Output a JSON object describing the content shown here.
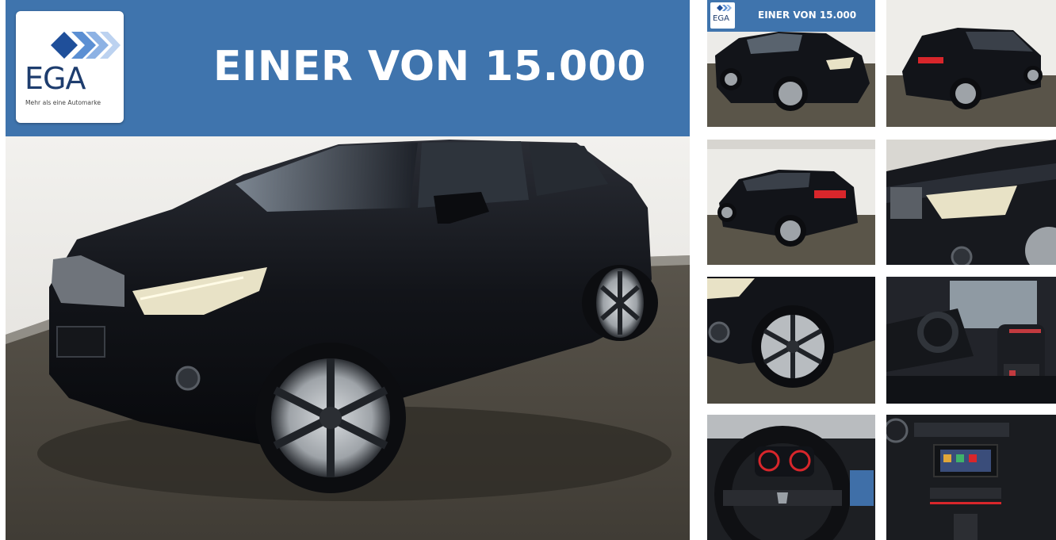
{
  "banner": {
    "title": "EINER VON 15.000",
    "logo_text": "EGA",
    "logo_tagline": "Mehr als eine Automarke"
  },
  "thumbnails": [
    {
      "label": "EINER VON 15.000",
      "logo_text": "EGA",
      "view": "front-three-quarter"
    },
    {
      "view": "rear-three-quarter"
    },
    {
      "view": "rear-side"
    },
    {
      "view": "headlight-detail"
    },
    {
      "view": "wheel-detail"
    },
    {
      "view": "interior-front-seats"
    },
    {
      "view": "steering-wheel"
    },
    {
      "view": "center-console"
    }
  ],
  "colors": {
    "banner_blue": "#3f74ad",
    "logo_navy": "#1e3d6e",
    "car_black": "#111318",
    "taillight_red": "#d8262b",
    "floor": "#4a463f",
    "wall": "#e9e7e2"
  },
  "icons": [
    "ega-chevron-logo"
  ]
}
